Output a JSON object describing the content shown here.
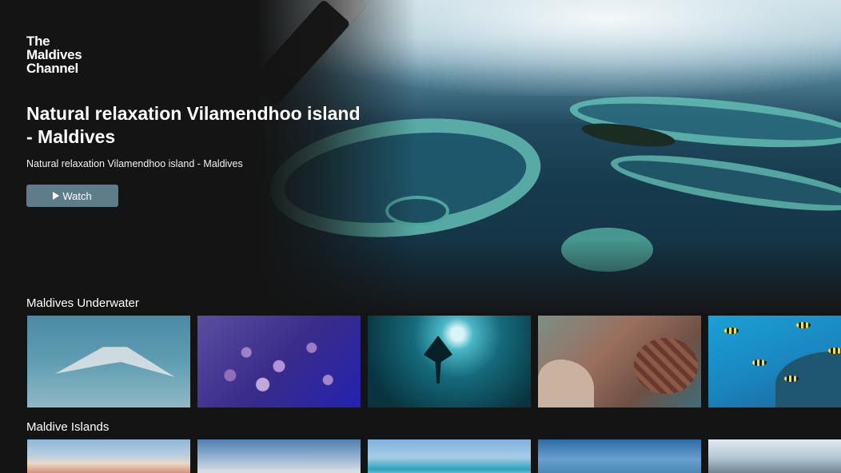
{
  "app": {
    "logo_lines": [
      "The",
      "Maldives",
      "Channel"
    ]
  },
  "hero": {
    "title": "Natural relaxation Vilamendhoo island - Maldives",
    "subtitle": "Natural relaxation Vilamendhoo island - Maldives",
    "watch_label": "Watch",
    "watch_icon": "play-icon"
  },
  "rows": [
    {
      "title": "Maldives Underwater",
      "items": [
        "manta-ray",
        "purple-fish-school",
        "deep-blue-silhouette",
        "sea-turtle",
        "striped-reef-fish"
      ]
    },
    {
      "title": "Maldive Islands",
      "items": [
        "male-city",
        "palm-buildings",
        "beach-person",
        "harbor",
        "overwater-villa"
      ]
    }
  ],
  "colors": {
    "background": "#141414",
    "watch_button": "#5e7c89"
  }
}
